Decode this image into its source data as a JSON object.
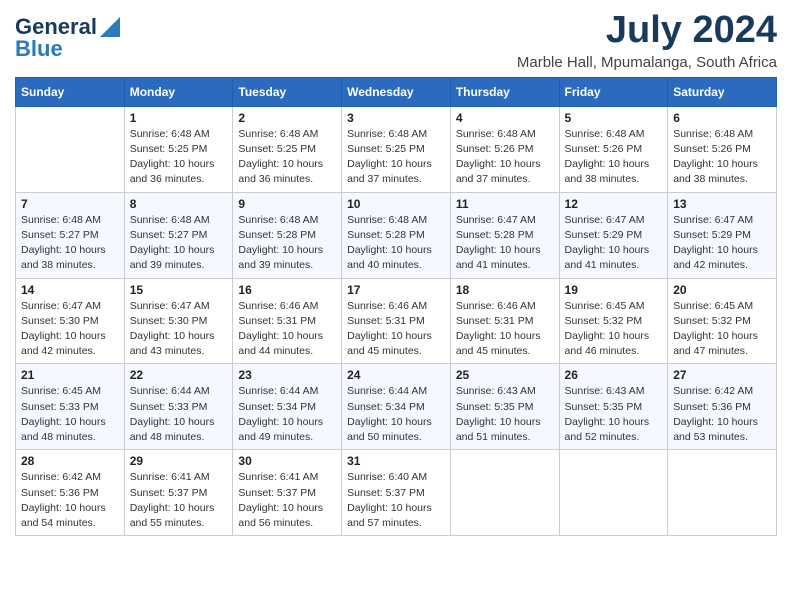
{
  "header": {
    "logo_line1": "General",
    "logo_line2": "Blue",
    "title": "July 2024",
    "subtitle": "Marble Hall, Mpumalanga, South Africa"
  },
  "columns": [
    "Sunday",
    "Monday",
    "Tuesday",
    "Wednesday",
    "Thursday",
    "Friday",
    "Saturday"
  ],
  "weeks": [
    [
      {
        "day": "",
        "info": ""
      },
      {
        "day": "1",
        "info": "Sunrise: 6:48 AM\nSunset: 5:25 PM\nDaylight: 10 hours\nand 36 minutes."
      },
      {
        "day": "2",
        "info": "Sunrise: 6:48 AM\nSunset: 5:25 PM\nDaylight: 10 hours\nand 36 minutes."
      },
      {
        "day": "3",
        "info": "Sunrise: 6:48 AM\nSunset: 5:25 PM\nDaylight: 10 hours\nand 37 minutes."
      },
      {
        "day": "4",
        "info": "Sunrise: 6:48 AM\nSunset: 5:26 PM\nDaylight: 10 hours\nand 37 minutes."
      },
      {
        "day": "5",
        "info": "Sunrise: 6:48 AM\nSunset: 5:26 PM\nDaylight: 10 hours\nand 38 minutes."
      },
      {
        "day": "6",
        "info": "Sunrise: 6:48 AM\nSunset: 5:26 PM\nDaylight: 10 hours\nand 38 minutes."
      }
    ],
    [
      {
        "day": "7",
        "info": "Sunrise: 6:48 AM\nSunset: 5:27 PM\nDaylight: 10 hours\nand 38 minutes."
      },
      {
        "day": "8",
        "info": "Sunrise: 6:48 AM\nSunset: 5:27 PM\nDaylight: 10 hours\nand 39 minutes."
      },
      {
        "day": "9",
        "info": "Sunrise: 6:48 AM\nSunset: 5:28 PM\nDaylight: 10 hours\nand 39 minutes."
      },
      {
        "day": "10",
        "info": "Sunrise: 6:48 AM\nSunset: 5:28 PM\nDaylight: 10 hours\nand 40 minutes."
      },
      {
        "day": "11",
        "info": "Sunrise: 6:47 AM\nSunset: 5:28 PM\nDaylight: 10 hours\nand 41 minutes."
      },
      {
        "day": "12",
        "info": "Sunrise: 6:47 AM\nSunset: 5:29 PM\nDaylight: 10 hours\nand 41 minutes."
      },
      {
        "day": "13",
        "info": "Sunrise: 6:47 AM\nSunset: 5:29 PM\nDaylight: 10 hours\nand 42 minutes."
      }
    ],
    [
      {
        "day": "14",
        "info": "Sunrise: 6:47 AM\nSunset: 5:30 PM\nDaylight: 10 hours\nand 42 minutes."
      },
      {
        "day": "15",
        "info": "Sunrise: 6:47 AM\nSunset: 5:30 PM\nDaylight: 10 hours\nand 43 minutes."
      },
      {
        "day": "16",
        "info": "Sunrise: 6:46 AM\nSunset: 5:31 PM\nDaylight: 10 hours\nand 44 minutes."
      },
      {
        "day": "17",
        "info": "Sunrise: 6:46 AM\nSunset: 5:31 PM\nDaylight: 10 hours\nand 45 minutes."
      },
      {
        "day": "18",
        "info": "Sunrise: 6:46 AM\nSunset: 5:31 PM\nDaylight: 10 hours\nand 45 minutes."
      },
      {
        "day": "19",
        "info": "Sunrise: 6:45 AM\nSunset: 5:32 PM\nDaylight: 10 hours\nand 46 minutes."
      },
      {
        "day": "20",
        "info": "Sunrise: 6:45 AM\nSunset: 5:32 PM\nDaylight: 10 hours\nand 47 minutes."
      }
    ],
    [
      {
        "day": "21",
        "info": "Sunrise: 6:45 AM\nSunset: 5:33 PM\nDaylight: 10 hours\nand 48 minutes."
      },
      {
        "day": "22",
        "info": "Sunrise: 6:44 AM\nSunset: 5:33 PM\nDaylight: 10 hours\nand 48 minutes."
      },
      {
        "day": "23",
        "info": "Sunrise: 6:44 AM\nSunset: 5:34 PM\nDaylight: 10 hours\nand 49 minutes."
      },
      {
        "day": "24",
        "info": "Sunrise: 6:44 AM\nSunset: 5:34 PM\nDaylight: 10 hours\nand 50 minutes."
      },
      {
        "day": "25",
        "info": "Sunrise: 6:43 AM\nSunset: 5:35 PM\nDaylight: 10 hours\nand 51 minutes."
      },
      {
        "day": "26",
        "info": "Sunrise: 6:43 AM\nSunset: 5:35 PM\nDaylight: 10 hours\nand 52 minutes."
      },
      {
        "day": "27",
        "info": "Sunrise: 6:42 AM\nSunset: 5:36 PM\nDaylight: 10 hours\nand 53 minutes."
      }
    ],
    [
      {
        "day": "28",
        "info": "Sunrise: 6:42 AM\nSunset: 5:36 PM\nDaylight: 10 hours\nand 54 minutes."
      },
      {
        "day": "29",
        "info": "Sunrise: 6:41 AM\nSunset: 5:37 PM\nDaylight: 10 hours\nand 55 minutes."
      },
      {
        "day": "30",
        "info": "Sunrise: 6:41 AM\nSunset: 5:37 PM\nDaylight: 10 hours\nand 56 minutes."
      },
      {
        "day": "31",
        "info": "Sunrise: 6:40 AM\nSunset: 5:37 PM\nDaylight: 10 hours\nand 57 minutes."
      },
      {
        "day": "",
        "info": ""
      },
      {
        "day": "",
        "info": ""
      },
      {
        "day": "",
        "info": ""
      }
    ]
  ]
}
